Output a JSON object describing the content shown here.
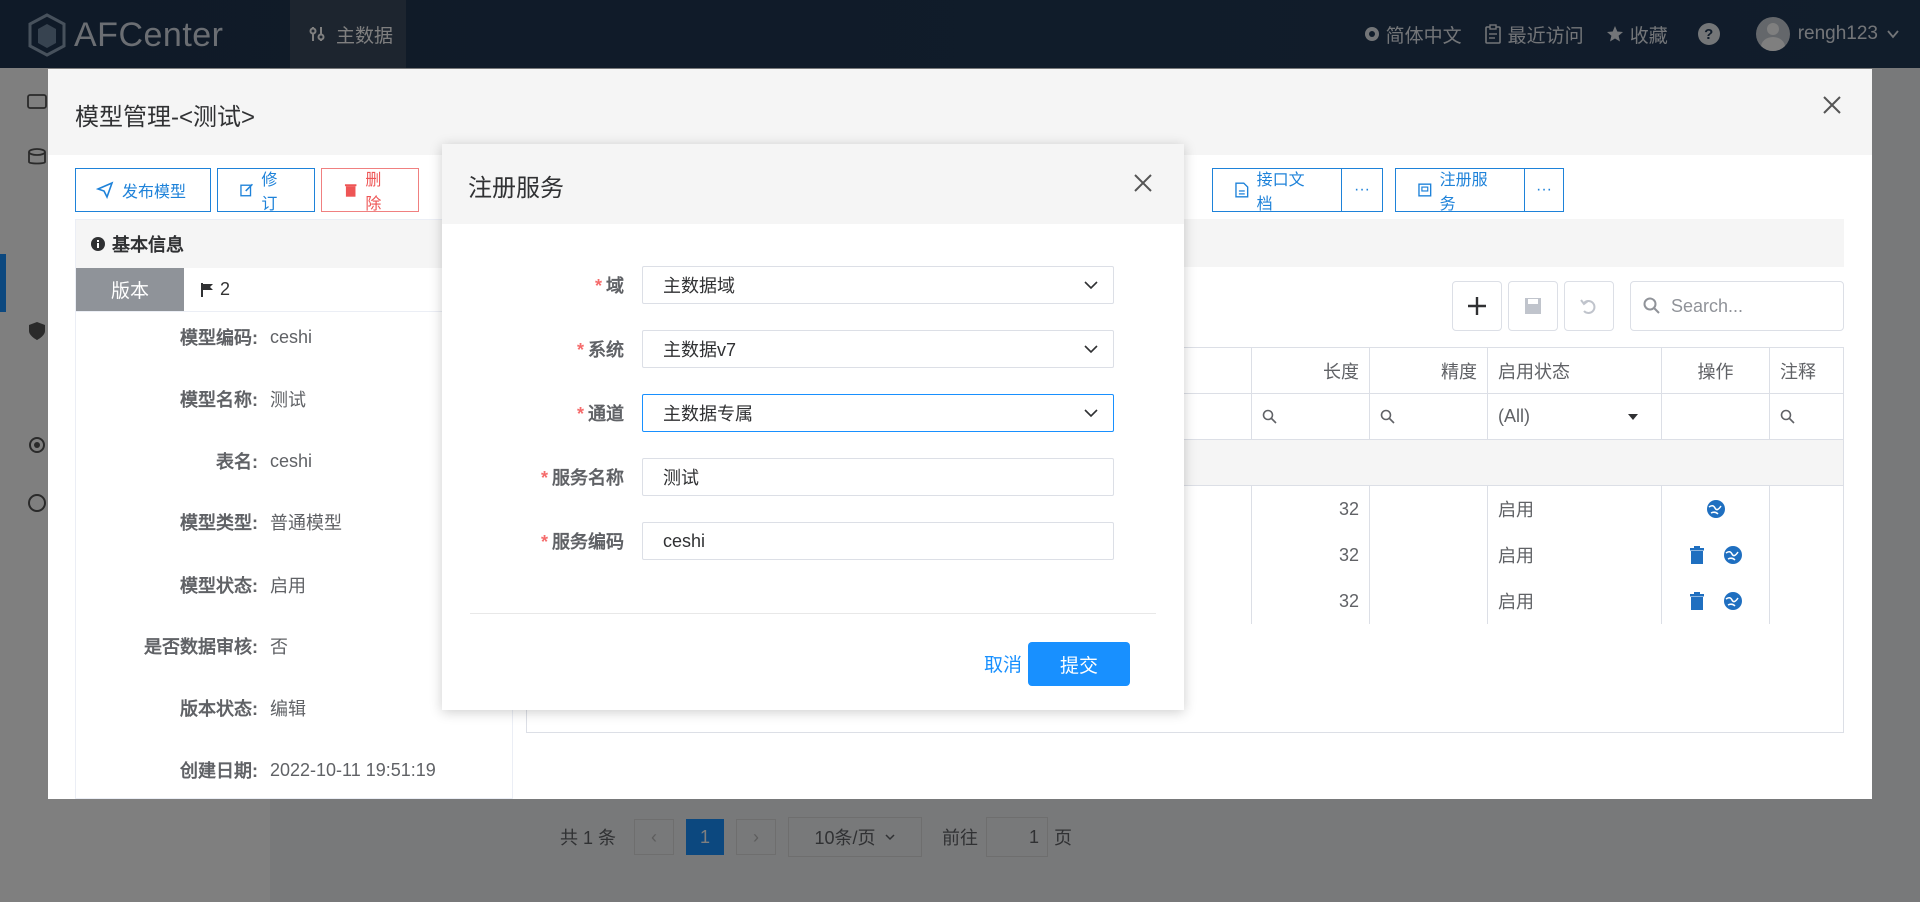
{
  "header": {
    "logo_text": "AFCenter",
    "nav_active": "主数据",
    "language": "简体中文",
    "recent": "最近访问",
    "favorites": "收藏",
    "help": "?",
    "username": "rengh123"
  },
  "background": {
    "pager": {
      "total": "共 1 条",
      "current_page": "1",
      "page_size": "10条/页",
      "goto_label": "前往",
      "goto_value": "1",
      "page_suffix": "页"
    }
  },
  "model_modal": {
    "title": "模型管理-<测试>",
    "toolbar": {
      "publish": "发布模型",
      "revise": "修订",
      "delete": "删除",
      "api_doc": "接口文档",
      "register": "注册服务",
      "more": "···"
    },
    "basic_info": {
      "header": "基本信息",
      "version_label": "版本",
      "version_value": "2",
      "fields": [
        {
          "label": "模型编码:",
          "value": "ceshi"
        },
        {
          "label": "模型名称:",
          "value": "测试"
        },
        {
          "label": "表名:",
          "value": "ceshi"
        },
        {
          "label": "模型类型:",
          "value": "普通模型"
        },
        {
          "label": "模型状态:",
          "value": "启用"
        },
        {
          "label": "是否数据审核:",
          "value": "否"
        },
        {
          "label": "版本状态:",
          "value": "编辑"
        },
        {
          "label": "创建日期:",
          "value": "2022-10-11 19:51:19"
        }
      ]
    },
    "grid": {
      "search_placeholder": "Search...",
      "columns": [
        "长度",
        "精度",
        "启用状态",
        "操作",
        "注释"
      ],
      "filter_status": "(All)",
      "rows": [
        {
          "length": "32",
          "status": "启用",
          "has_delete": false
        },
        {
          "length": "32",
          "status": "启用",
          "has_delete": true
        },
        {
          "length": "32",
          "status": "启用",
          "has_delete": true
        }
      ]
    }
  },
  "register_modal": {
    "title": "注册服务",
    "fields": [
      {
        "label": "域",
        "value": "主数据域",
        "type": "select"
      },
      {
        "label": "系统",
        "value": "主数据v7",
        "type": "select"
      },
      {
        "label": "通道",
        "value": "主数据专属",
        "type": "select"
      },
      {
        "label": "服务名称",
        "value": "测试",
        "type": "input"
      },
      {
        "label": "服务编码",
        "value": "ceshi",
        "type": "input"
      }
    ],
    "cancel": "取消",
    "submit": "提交"
  },
  "colors": {
    "primary": "#1890ff",
    "header_bg": "#1f3550",
    "danger": "#ee5555",
    "required": "#f56c6c"
  }
}
